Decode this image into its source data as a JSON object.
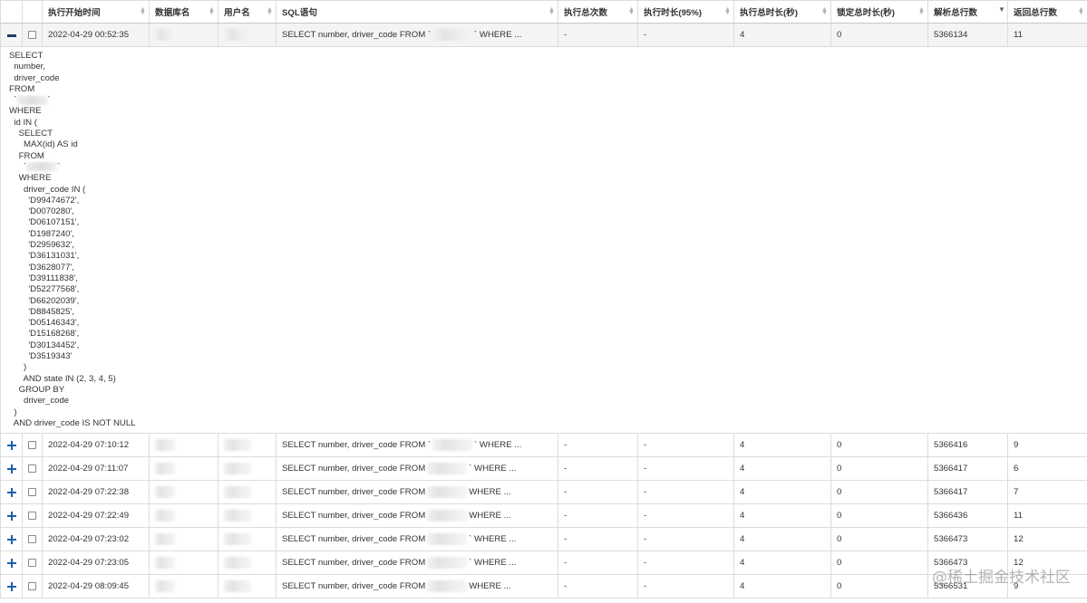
{
  "table": {
    "columns": [
      {
        "key": "expand",
        "label": ""
      },
      {
        "key": "select",
        "label": ""
      },
      {
        "key": "start_time",
        "label": "执行开始时间"
      },
      {
        "key": "database",
        "label": "数据库名"
      },
      {
        "key": "user",
        "label": "用户名"
      },
      {
        "key": "sql",
        "label": "SQL语句"
      },
      {
        "key": "exec_count",
        "label": "执行总次数"
      },
      {
        "key": "exec_p95",
        "label": "执行时长(95%)"
      },
      {
        "key": "exec_total",
        "label": "执行总时长(秒)"
      },
      {
        "key": "lock_total",
        "label": "锁定总时长(秒)"
      },
      {
        "key": "rows_examined",
        "label": "解析总行数"
      },
      {
        "key": "rows_returned",
        "label": "返回总行数"
      }
    ],
    "sorted_column": "rows_examined",
    "sorted_direction": "desc",
    "rows": [
      {
        "start_time": "2022-04-29 00:52:35",
        "sql_prefix": "SELECT number, driver_code FROM `",
        "sql_suffix": "` WHERE ...",
        "exec_count": "-",
        "exec_p95": "-",
        "exec_total": "4",
        "lock_total": "0",
        "rows_examined": "5366134",
        "rows_returned": "11",
        "expanded": true
      },
      {
        "start_time": "2022-04-29 07:10:12",
        "sql_prefix": "SELECT number, driver_code FROM `",
        "sql_suffix": "` WHERE ...",
        "exec_count": "-",
        "exec_p95": "-",
        "exec_total": "4",
        "lock_total": "0",
        "rows_examined": "5366416",
        "rows_returned": "9",
        "expanded": false
      },
      {
        "start_time": "2022-04-29 07:11:07",
        "sql_prefix": "SELECT number, driver_code FROM",
        "sql_suffix": "` WHERE ...",
        "exec_count": "-",
        "exec_p95": "-",
        "exec_total": "4",
        "lock_total": "0",
        "rows_examined": "5366417",
        "rows_returned": "6",
        "expanded": false
      },
      {
        "start_time": "2022-04-29 07:22:38",
        "sql_prefix": "SELECT number, driver_code FROM",
        "sql_suffix": "WHERE ...",
        "exec_count": "-",
        "exec_p95": "-",
        "exec_total": "4",
        "lock_total": "0",
        "rows_examined": "5366417",
        "rows_returned": "7",
        "expanded": false
      },
      {
        "start_time": "2022-04-29 07:22:49",
        "sql_prefix": "SELECT number, driver_code FROM",
        "sql_suffix": "WHERE ...",
        "exec_count": "-",
        "exec_p95": "-",
        "exec_total": "4",
        "lock_total": "0",
        "rows_examined": "5366436",
        "rows_returned": "11",
        "expanded": false
      },
      {
        "start_time": "2022-04-29 07:23:02",
        "sql_prefix": "SELECT number, driver_code FROM",
        "sql_suffix": "` WHERE ...",
        "exec_count": "-",
        "exec_p95": "-",
        "exec_total": "4",
        "lock_total": "0",
        "rows_examined": "5366473",
        "rows_returned": "12",
        "expanded": false
      },
      {
        "start_time": "2022-04-29 07:23:05",
        "sql_prefix": "SELECT number, driver_code FROM",
        "sql_suffix": "` WHERE ...",
        "exec_count": "-",
        "exec_p95": "-",
        "exec_total": "4",
        "lock_total": "0",
        "rows_examined": "5366473",
        "rows_returned": "12",
        "expanded": false
      },
      {
        "start_time": "2022-04-29 08:09:45",
        "sql_prefix": "SELECT number, driver_code FROM",
        "sql_suffix": "WHERE ...",
        "exec_count": "-",
        "exec_p95": "-",
        "exec_total": "4",
        "lock_total": "0",
        "rows_examined": "5366531",
        "rows_returned": "9",
        "expanded": false
      }
    ],
    "expanded_sql": {
      "head": "SELECT\n  number,\n  driver_code\nFROM\n  `",
      "mid1": "`\nWHERE\n  id IN (\n    SELECT\n      MAX(id) AS id\n    FROM\n      `",
      "tail": "`\n    WHERE\n      driver_code IN (\n        'D99474672',\n        'D0070280',\n        'D06107151',\n        'D1987240',\n        'D2959632',\n        'D36131031',\n        'D3628077',\n        'D39111838',\n        'D52277568',\n        'D66202039',\n        'D8845825',\n        'D05146343',\n        'D15168268',\n        'D30134452',\n        'D3519343'\n      )\n      AND state IN (2, 3, 4, 5)\n    GROUP BY\n      driver_code\n  )\n  AND driver_code IS NOT NULL"
    }
  },
  "icons": {
    "expand": "plus-icon",
    "collapse": "minus-icon",
    "sort": "sort-arrows-icon",
    "select": "checkbox"
  },
  "colors": {
    "toggle": "#1f5fa8",
    "border": "#dcdcdc",
    "expanded_row_bg": "#f4f4f4"
  },
  "watermark": "@稀土掘金技术社区"
}
